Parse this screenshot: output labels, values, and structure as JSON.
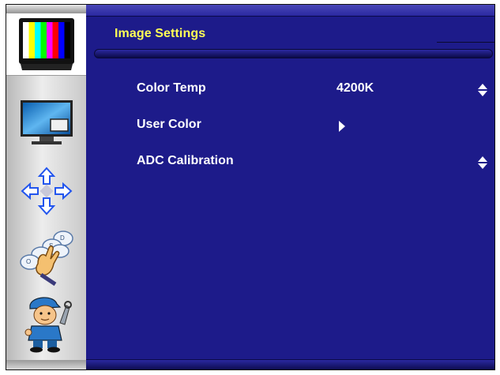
{
  "menu": {
    "title": "Image Settings",
    "rows": [
      {
        "label": "Color Temp",
        "value": "4200K",
        "control": "updown-arrows-icon"
      },
      {
        "label": "User Color",
        "value": "",
        "control": "submenu-arrow-icon"
      },
      {
        "label": "ADC Calibration",
        "value": "",
        "control": "updown-arrows-icon"
      }
    ]
  },
  "sidebar": {
    "items": [
      {
        "icon": "color-bars-monitor-icon",
        "active": true
      },
      {
        "icon": "picture-in-picture-monitor-icon",
        "active": false
      },
      {
        "icon": "position-arrows-icon",
        "active": false
      },
      {
        "icon": "keypad-hand-icon",
        "active": false
      },
      {
        "icon": "technician-icon",
        "active": false
      }
    ]
  },
  "colors": {
    "panel_bg": "#1d1b8a",
    "title_text": "#ffff55",
    "item_text": "#ffffff",
    "sidebar_bg": "#e0e0e0"
  }
}
